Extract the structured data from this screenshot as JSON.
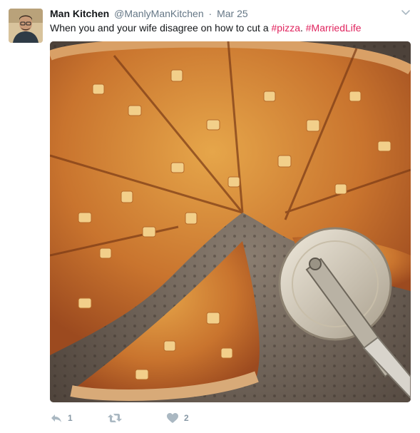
{
  "tweet": {
    "display_name": "Man Kitchen",
    "handle": "@ManlyManKitchen",
    "separator": "·",
    "date": "Mar 25",
    "text_before": "When you and your wife disagree on how to cut a ",
    "hashtag_1": "#pizza",
    "text_middle": ". ",
    "hashtag_2": "#MarriedLife"
  },
  "actions": {
    "reply_count": "1",
    "retweet_count": "",
    "like_count": "2"
  },
  "colors": {
    "hashtag": "#e0245e",
    "meta_gray": "#657786",
    "action_gray": "#8899a6"
  },
  "icons": [
    "caret-down-icon",
    "reply-icon",
    "retweet-icon",
    "heart-icon"
  ]
}
